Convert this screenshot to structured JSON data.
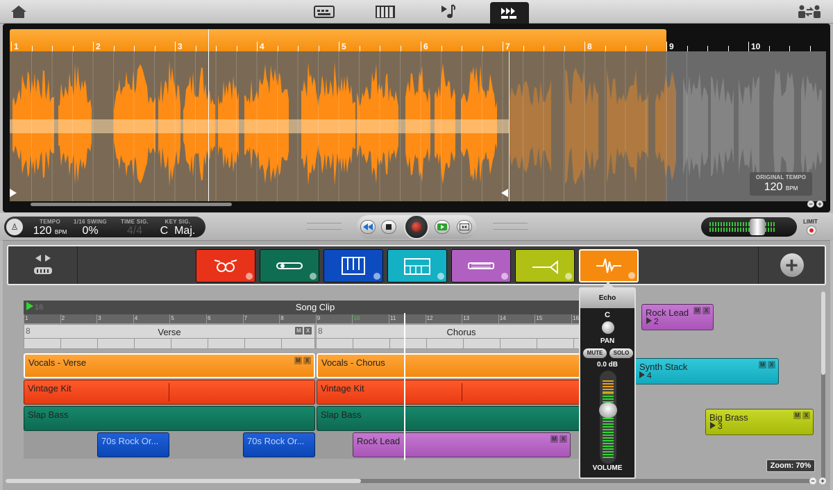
{
  "topbar": {
    "home_icon": "home-icon",
    "tabs": [
      {
        "icon": "keyboard-view-icon"
      },
      {
        "icon": "piano-roll-icon"
      },
      {
        "icon": "music-note-icon"
      },
      {
        "icon": "fast-forward-icon",
        "active": true
      }
    ],
    "right_icon": "users-swap-icon"
  },
  "waveform": {
    "ruler_marks": [
      "1",
      "2",
      "3",
      "4",
      "5",
      "6",
      "7",
      "8",
      "9",
      "10"
    ],
    "original_tempo": {
      "label": "ORIGINAL TEMPO",
      "value": "120",
      "unit": "BPM"
    },
    "zoom_out": "−",
    "zoom_in": "+"
  },
  "transport": {
    "tempo": {
      "label": "TEMPO",
      "value": "120",
      "unit": "BPM"
    },
    "swing": {
      "label": "1/16 SWING",
      "value": "0%"
    },
    "time_sig": {
      "label": "TIME SIG.",
      "value": "4/4"
    },
    "key_sig": {
      "label": "KEY SIG.",
      "value": "C  Maj."
    },
    "limit_label": "LIMIT"
  },
  "instruments": [
    {
      "name": "drums",
      "color": "#e8321a"
    },
    {
      "name": "guitar",
      "color": "#0f6e52"
    },
    {
      "name": "keyboard",
      "color": "#0c4cc0"
    },
    {
      "name": "synth",
      "color": "#14b0c4"
    },
    {
      "name": "bass-guitar",
      "color": "#b060c0"
    },
    {
      "name": "brass",
      "color": "#b0c015"
    },
    {
      "name": "vocal-wave",
      "color": "#f58a0e",
      "selected": true
    }
  ],
  "arrangement": {
    "song_clip": {
      "count": "16",
      "title": "Song Clip"
    },
    "bar_numbers": [
      "1",
      "2",
      "3",
      "4",
      "5",
      "6",
      "7",
      "8",
      "9",
      "10",
      "11",
      "12",
      "13",
      "14",
      "15",
      "16"
    ],
    "sections": [
      {
        "count": "8",
        "title": "Verse"
      },
      {
        "count": "8",
        "title": "Chorus"
      }
    ],
    "clips": {
      "vocals_verse": "Vocals - Verse",
      "vocals_chorus": "Vocals - Chorus",
      "vintage_kit_1": "Vintage Kit",
      "vintage_kit_2": "Vintage Kit",
      "slap_bass_1": "Slap Bass",
      "slap_bass_2": "Slap Bass",
      "rock_or_1": "70s Rock Or...",
      "rock_or_2": "70s Rock Or...",
      "rock_lead": "Rock Lead"
    },
    "side_clips": [
      {
        "title": "Rock Lead",
        "number": "2"
      },
      {
        "title": "Synth Stack",
        "number": "4"
      },
      {
        "title": "Big Brass",
        "number": "3"
      }
    ],
    "mx": {
      "m": "M",
      "x": "X"
    }
  },
  "mixer": {
    "title": "Echo",
    "pan_value": "C",
    "pan_label": "PAN",
    "mute": "MUTE",
    "solo": "SOLO",
    "db": "0.0 dB",
    "volume_label": "VOLUME"
  },
  "zoom": "Zoom: 70%"
}
